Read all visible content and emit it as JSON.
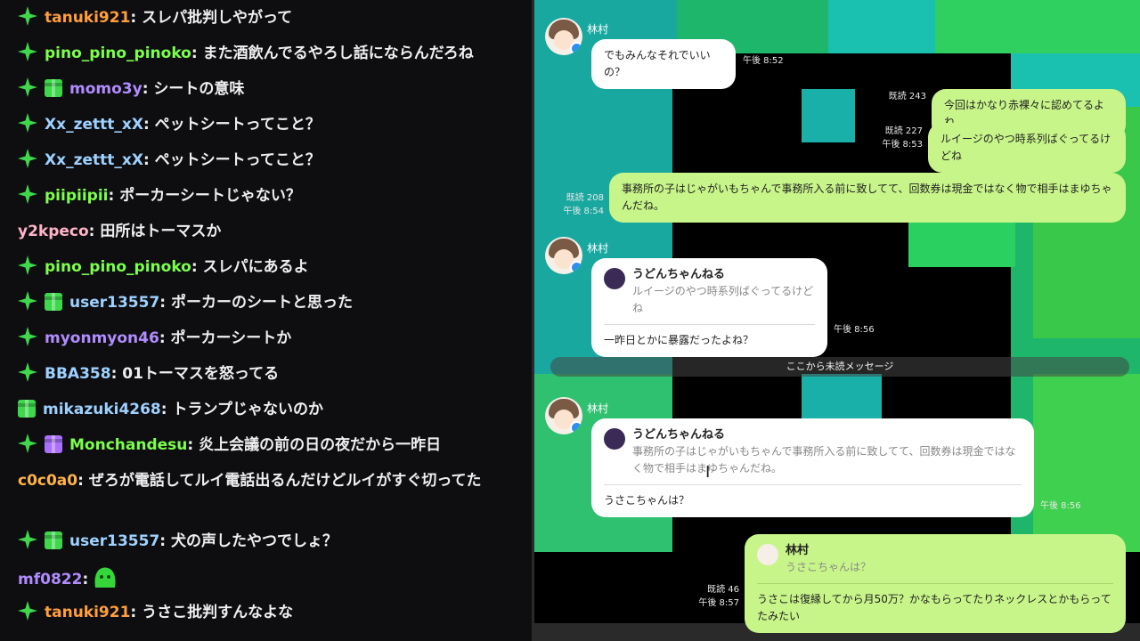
{
  "colors": {
    "moderator_badge": "#3fd84d",
    "gift_badge_green": "#3fd84d",
    "gift_badge_purple": "#a970ff"
  },
  "chat": {
    "messages": [
      {
        "user": "tanuki921",
        "user_color": "#ff9e3d",
        "badges": [
          "moderator-icon"
        ],
        "text": ": スレパ批判しやがって"
      },
      {
        "user": "pino_pino_pinoko",
        "user_color": "#7bff4a",
        "badges": [
          "moderator-icon"
        ],
        "text": ": また酒飲んでるやろし話にならんだろね"
      },
      {
        "user": "momo3y",
        "user_color": "#b18cff",
        "badges": [
          "moderator-icon",
          "gift-green-icon"
        ],
        "text": ": シートの意味"
      },
      {
        "user": "Xx_zettt_xX",
        "user_color": "#9ed1ff",
        "badges": [
          "moderator-icon"
        ],
        "text": ": ペットシートってこと？"
      },
      {
        "user": "Xx_zettt_xX",
        "user_color": "#9ed1ff",
        "badges": [
          "moderator-icon"
        ],
        "text": ": ペットシートってこと？"
      },
      {
        "user": "piipiipii",
        "user_color": "#7bff4a",
        "badges": [
          "moderator-icon"
        ],
        "text": ": ポーカーシートじゃない？"
      },
      {
        "user": "y2kpeco",
        "user_color": "#ffb3c7",
        "badges": [],
        "text": ": 田所はトーマスか"
      },
      {
        "user": "pino_pino_pinoko",
        "user_color": "#7bff4a",
        "badges": [
          "moderator-icon"
        ],
        "text": ": スレパにあるよ"
      },
      {
        "user": "user13557",
        "user_color": "#9ed1ff",
        "badges": [
          "moderator-icon",
          "gift-green-icon"
        ],
        "text": ": ポーカーのシートと思った"
      },
      {
        "user": "myonmyon46",
        "user_color": "#b18cff",
        "badges": [
          "moderator-icon"
        ],
        "text": ": ポーカーシートか"
      },
      {
        "user": "BBA358",
        "user_color": "#9ed1ff",
        "badges": [
          "moderator-icon"
        ],
        "text": ": 01トーマスを怒ってる"
      },
      {
        "user": "mikazuki4268",
        "user_color": "#9ed1ff",
        "badges": [
          "gift-green-icon"
        ],
        "text": ": トランプじゃないのか"
      },
      {
        "user": "Monchandesu",
        "user_color": "#7bff4a",
        "badges": [
          "moderator-icon",
          "gift-purple-icon"
        ],
        "text": ": 炎上会議の前の日の夜だから一昨日"
      },
      {
        "user": "c0c0a0",
        "user_color": "#ffb347",
        "badges": [],
        "text": ": ぜろが電話してルイ電話出るんだけどルイがすぐ切ってた"
      },
      {
        "user": "user13557",
        "user_color": "#9ed1ff",
        "badges": [
          "moderator-icon",
          "gift-green-icon"
        ],
        "text": ": 犬の声したやつでしょ？"
      },
      {
        "user": "mf0822",
        "user_color": "#b18cff",
        "badges": [],
        "text": ":",
        "emote": "green-blob-emote"
      },
      {
        "user": "tanuki921",
        "user_color": "#ff9e3d",
        "badges": [
          "moderator-icon"
        ],
        "text": ": うさこ批判すんなよな"
      }
    ]
  },
  "line": {
    "sender_name": "林村",
    "messages": {
      "m1": {
        "text": "でもみんなそれでいいの？",
        "time": "午後 8:52"
      },
      "m2": {
        "read": "既読 243",
        "text": "今回はかなり赤裸々に認めてるよね"
      },
      "m3": {
        "read": "既読 227",
        "time": "午後 8:53",
        "text": "ルイージのやつ時系列ばぐってるけどね"
      },
      "m4": {
        "read": "既読 208",
        "time": "午後 8:54",
        "text": "事務所の子はじゃがいもちゃんで事務所入る前に致してて、回数券は現金ではなく物で相手はまゆちゃんだね。"
      },
      "m5": {
        "quote_name": "うどんちゃんねる",
        "quote_text": "ルイージのやつ時系列ばぐってるけどね",
        "text": "一昨日とかに暴露だったよね？",
        "time": "午後 8:56"
      },
      "m6": {
        "quote_name": "うどんちゃんねる",
        "quote_text": "事務所の子はじゃがいもちゃんで事務所入る前に致してて、回数券は現金ではなく物で相手はまゆちゃんだね。",
        "text": "うさこちゃんは？",
        "time": "午後 8:56"
      },
      "m7": {
        "read": "既読 46",
        "time": "午後 8:57",
        "quote_name": "林村",
        "quote_text": "うさこちゃんは？",
        "text": "うさこは復縁してから月50万？かなもらってたりネックレスとかもらってたみたい"
      }
    },
    "unread_divider": "ここから未読メッセージ"
  }
}
